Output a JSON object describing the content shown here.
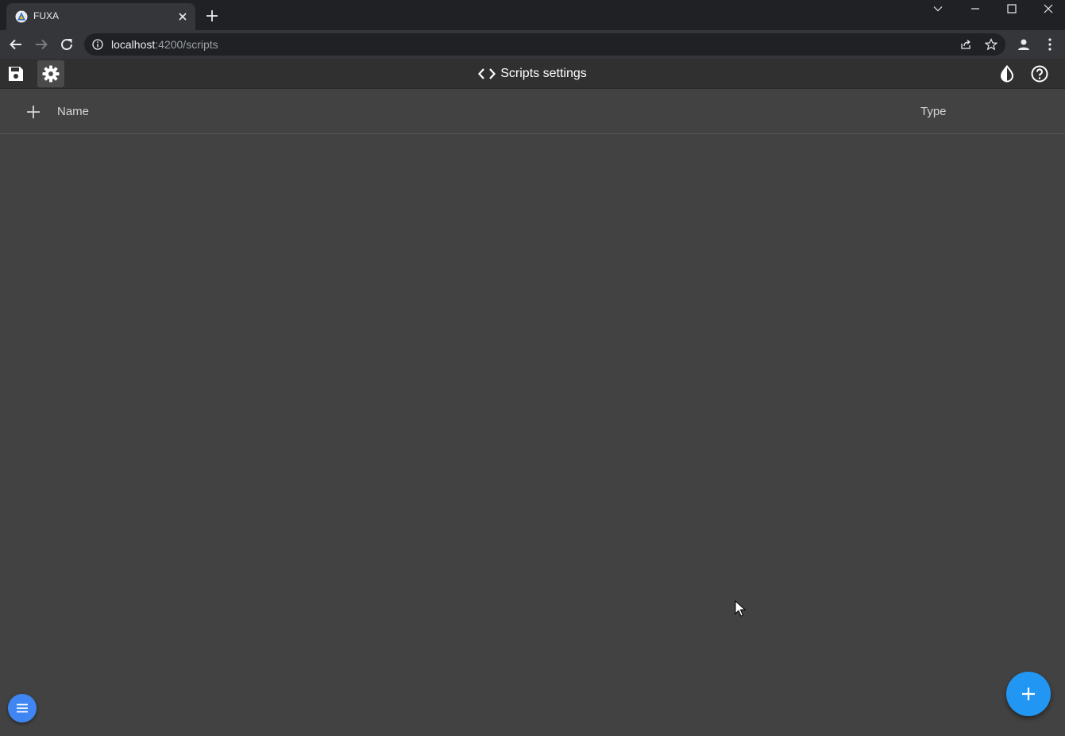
{
  "browser": {
    "tab_title": "FUXA",
    "url_host": "localhost",
    "url_rest": ":4200/scripts"
  },
  "header": {
    "title": "Scripts settings"
  },
  "table": {
    "columns": [
      "Name",
      "Type"
    ]
  },
  "colors": {
    "fab": "#2196f3",
    "menu_fab": "#3f86f3",
    "background": "#424242",
    "header": "#303030"
  }
}
